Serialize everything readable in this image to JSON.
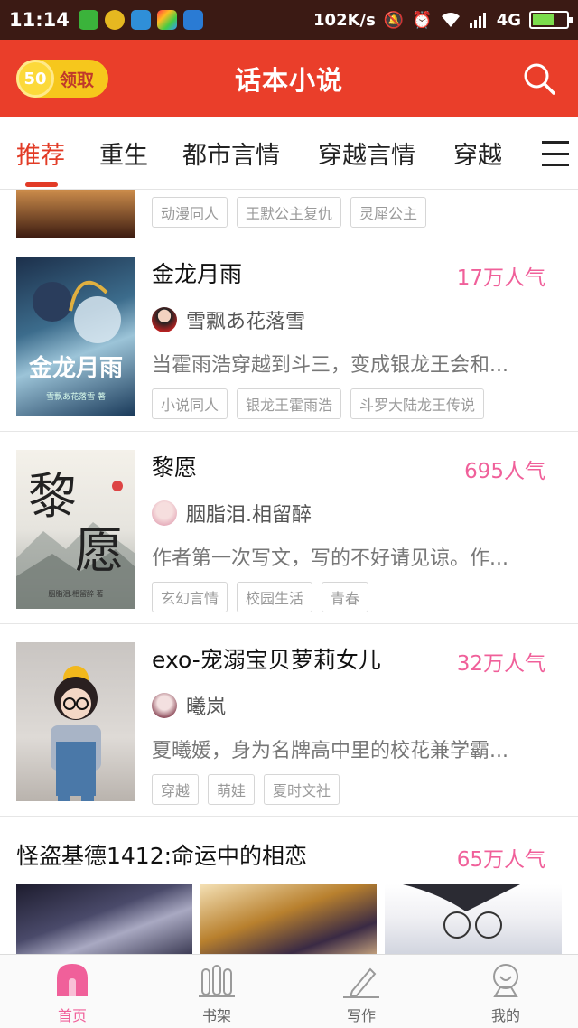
{
  "status_bar": {
    "time": "11:14",
    "speed": "102K/s",
    "network": "4G",
    "battery_level": 0.65
  },
  "header": {
    "coin_count": "50",
    "coin_label": "领取",
    "title": "话本小说",
    "accent": "#ea3e2a"
  },
  "tabs": [
    {
      "label": "推荐"
    },
    {
      "label": "重生"
    },
    {
      "label": "都市言情"
    },
    {
      "label": "穿越言情"
    },
    {
      "label": "穿越"
    }
  ],
  "partial_row": {
    "tags": [
      "动漫同人",
      "王默公主复仇",
      "灵犀公主"
    ]
  },
  "books": [
    {
      "title": "金龙月雨",
      "popularity": "17万人气",
      "author": "雪飘あ花落雪",
      "description": "当霍雨浩穿越到斗三，变成银龙王会和...",
      "tags": [
        "小说同人",
        "银龙王霍雨浩",
        "斗罗大陆龙王传说"
      ],
      "cover_text": "金龙月雨",
      "cover_sub": "雪飘あ花落雪 著"
    },
    {
      "title": "黎愿",
      "popularity": "695人气",
      "author": "胭脂泪.相留醉",
      "description": "作者第一次写文，写的不好请见谅。作...",
      "tags": [
        "玄幻言情",
        "校园生活",
        "青春"
      ],
      "cover_text": "黎愿",
      "cover_sub": "胭脂泪.相留醉 著"
    },
    {
      "title": "exo-宠溺宝贝萝莉女儿",
      "popularity": "32万人气",
      "author": "曦岚",
      "description": "夏曦媛，身为名牌高中里的校花兼学霸...",
      "tags": [
        "穿越",
        "萌娃",
        "夏时文社"
      ]
    }
  ],
  "featured": {
    "title": "怪盗基德1412:命运中的相恋",
    "popularity": "65万人气"
  },
  "bottom_nav": [
    {
      "label": "首页",
      "icon": "home-icon"
    },
    {
      "label": "书架",
      "icon": "bookshelf-icon"
    },
    {
      "label": "写作",
      "icon": "pen-icon"
    },
    {
      "label": "我的",
      "icon": "profile-icon"
    }
  ]
}
